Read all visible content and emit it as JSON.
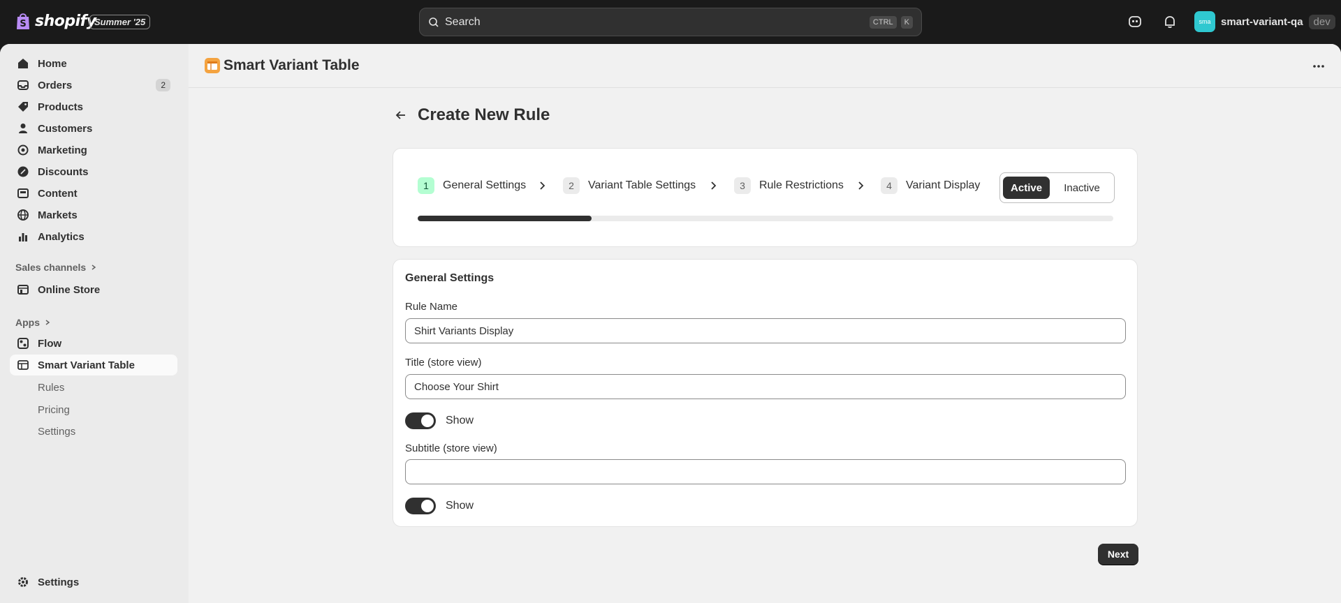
{
  "topbar": {
    "logo_text": "shopify",
    "edition_badge": "Summer '25",
    "search_placeholder": "Search",
    "shortcut_key1": "CTRL",
    "shortcut_key2": "K",
    "store_avatar": "sma",
    "store_name": "smart-variant-qa",
    "store_badge": "dev"
  },
  "sidebar": {
    "items": [
      {
        "label": "Home",
        "icon": "home-icon"
      },
      {
        "label": "Orders",
        "icon": "inbox-icon",
        "count": "2"
      },
      {
        "label": "Products",
        "icon": "tag-icon"
      },
      {
        "label": "Customers",
        "icon": "person-icon"
      },
      {
        "label": "Marketing",
        "icon": "target-icon"
      },
      {
        "label": "Discounts",
        "icon": "discount-icon"
      },
      {
        "label": "Content",
        "icon": "content-icon"
      },
      {
        "label": "Markets",
        "icon": "globe-icon"
      },
      {
        "label": "Analytics",
        "icon": "chart-icon"
      }
    ],
    "sales_channels_label": "Sales channels",
    "online_store_label": "Online Store",
    "apps_label": "Apps",
    "flow_label": "Flow",
    "app_label": "Smart Variant Table",
    "app_subitems": [
      "Rules",
      "Pricing",
      "Settings"
    ],
    "settings_label": "Settings"
  },
  "app_header": {
    "title": "Smart Variant Table"
  },
  "page": {
    "title": "Create New Rule",
    "steps": [
      {
        "num": "1",
        "label": "General Settings"
      },
      {
        "num": "2",
        "label": "Variant Table Settings"
      },
      {
        "num": "3",
        "label": "Rule Restrictions"
      },
      {
        "num": "4",
        "label": "Variant Display"
      }
    ],
    "status_active": "Active",
    "status_inactive": "Inactive",
    "progress_fraction": 0.25,
    "form": {
      "section_title": "General Settings",
      "rule_name_label": "Rule Name",
      "rule_name_value": "Shirt Variants Display",
      "title_label": "Title (store view)",
      "title_value": "Choose Your Shirt",
      "title_show_label": "Show",
      "subtitle_label": "Subtitle (store view)",
      "subtitle_value": "",
      "subtitle_show_label": "Show"
    },
    "next_label": "Next"
  },
  "colors": {
    "accent_dark": "#303030",
    "step_active_bg": "#b4fed2",
    "avatar_bg": "#2fc8d0",
    "app_icon": "#f4a340"
  }
}
